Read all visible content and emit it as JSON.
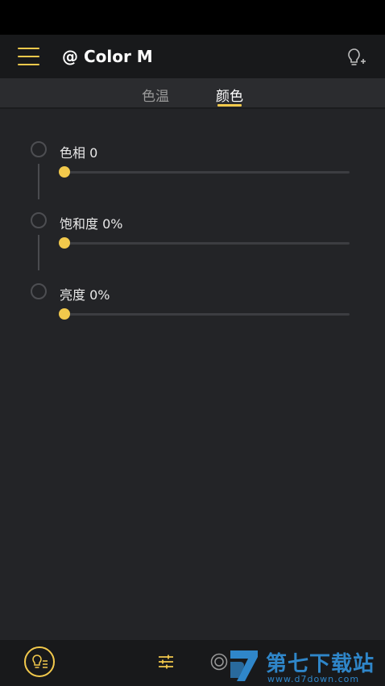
{
  "header": {
    "title": "@ Color M",
    "menu_icon": "hamburger-icon",
    "add_icon": "lightbulb-add-icon"
  },
  "tabs": [
    {
      "label": "色温",
      "active": false
    },
    {
      "label": "颜色",
      "active": true
    }
  ],
  "settings": [
    {
      "label": "色相 0",
      "value_fraction": 0
    },
    {
      "label": "饱和度 0%",
      "value_fraction": 0
    },
    {
      "label": "亮度 0%",
      "value_fraction": 0
    }
  ],
  "bottom_nav": {
    "items": [
      "lightbulb-list-icon",
      "sliders-icon",
      "target-circle-icon"
    ]
  },
  "watermark": {
    "title": "第七下载站",
    "url": "www.d7down.com"
  },
  "colors": {
    "accent": "#f2c94c",
    "background": "#232427",
    "header_background": "#18191b",
    "watermark": "#2f86c9"
  }
}
